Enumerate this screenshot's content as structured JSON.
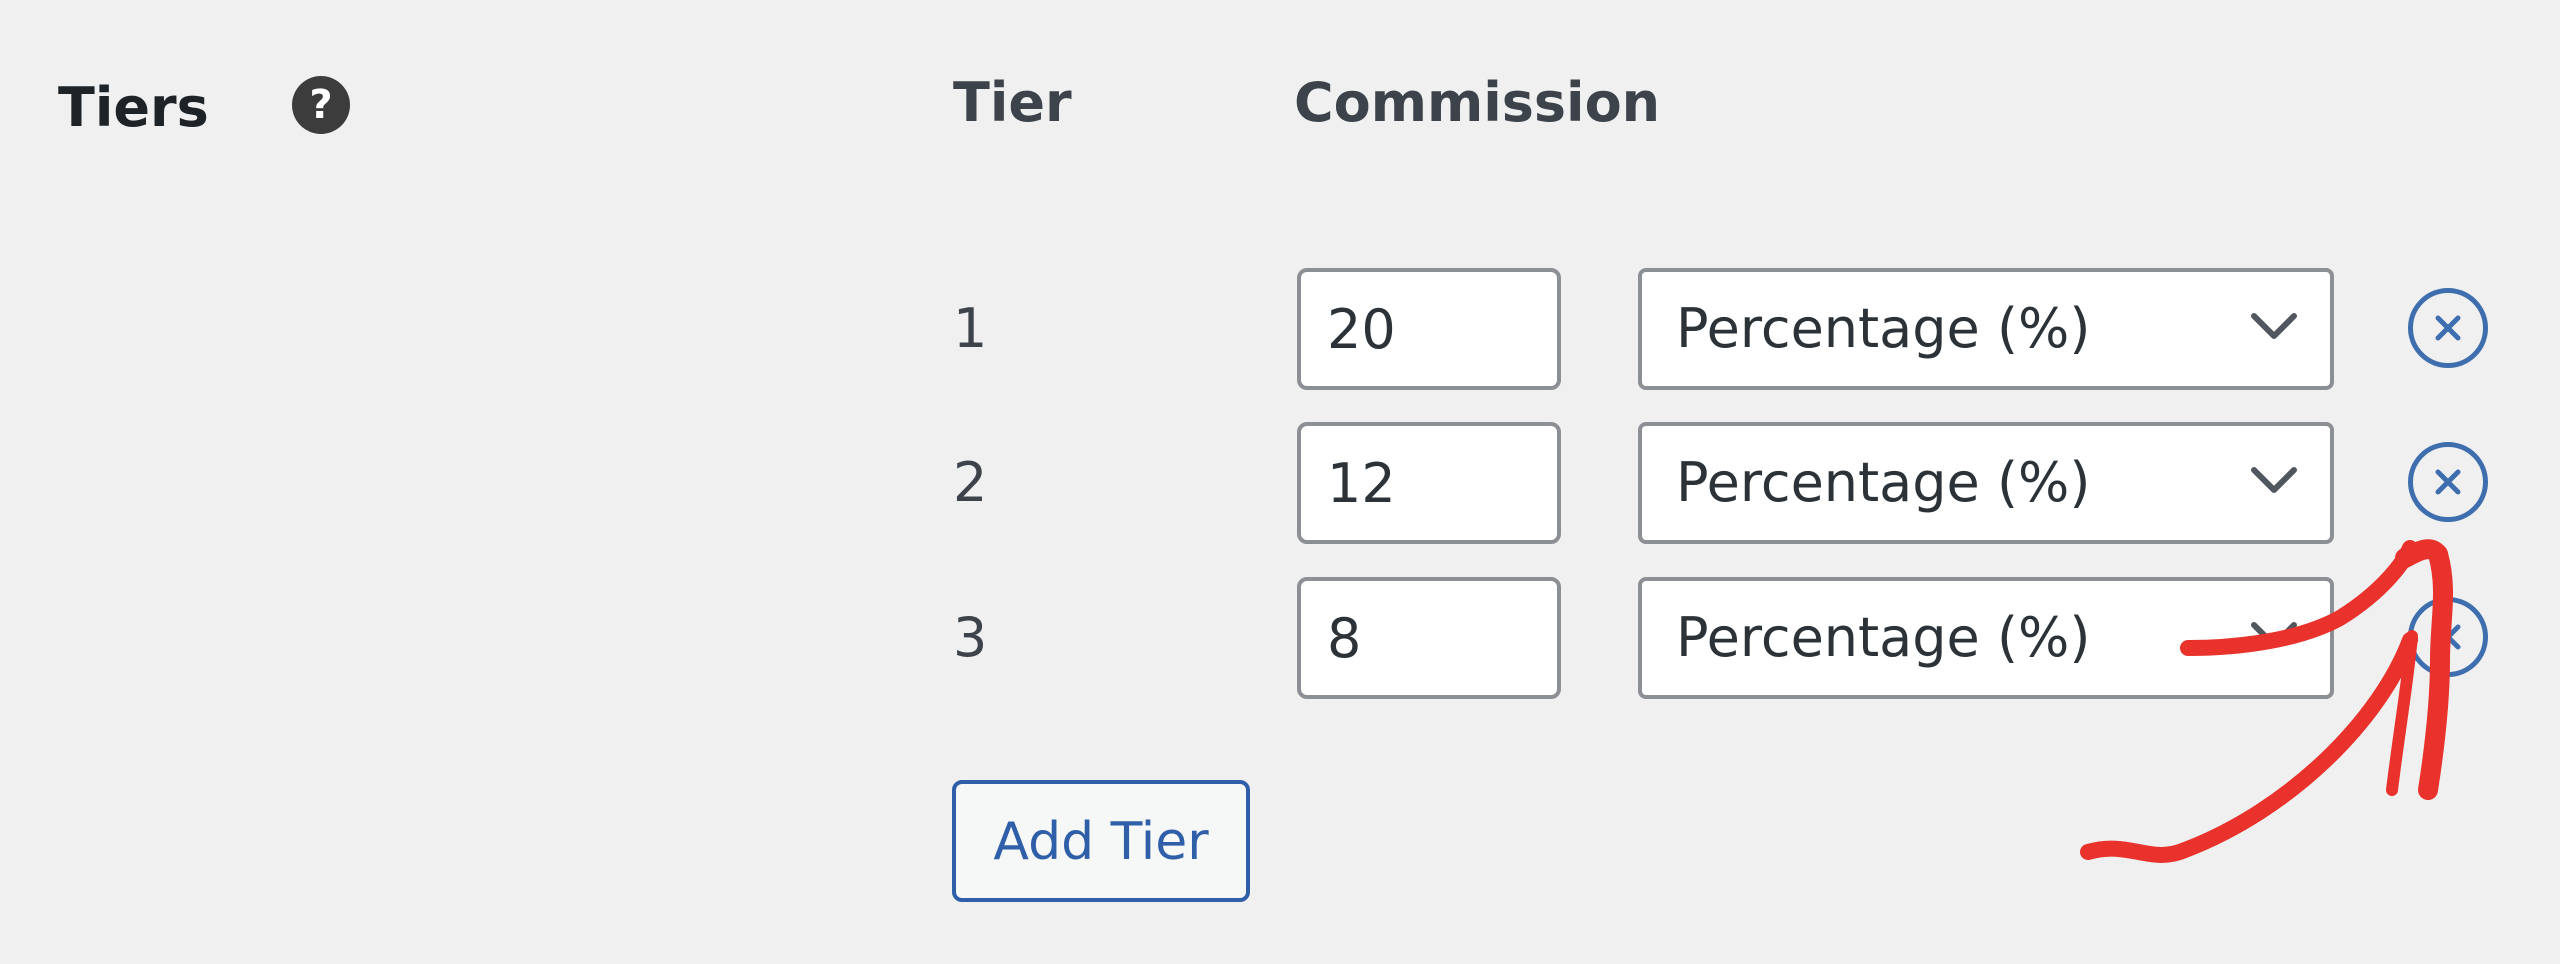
{
  "section": {
    "label": "Tiers",
    "help_icon": "question-mark-icon"
  },
  "columns": {
    "tier": "Tier",
    "commission": "Commission"
  },
  "tiers": [
    {
      "number": "1",
      "amount": "20",
      "type": "Percentage (%)"
    },
    {
      "number": "2",
      "amount": "12",
      "type": "Percentage (%)"
    },
    {
      "number": "3",
      "amount": "8",
      "type": "Percentage (%)"
    }
  ],
  "icons": {
    "remove": "remove-circle-x-icon",
    "dropdown": "chevron-down-icon"
  },
  "actions": {
    "add_tier_label": "Add Tier"
  },
  "colors": {
    "background": "#f0f0f1",
    "accent": "#2f5fa8",
    "annotation_arrow": "#e8322b"
  }
}
